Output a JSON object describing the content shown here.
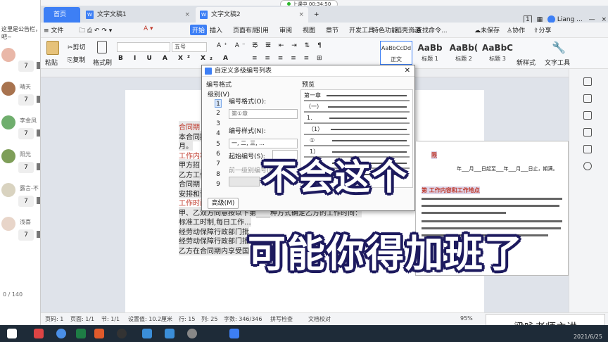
{
  "chat": {
    "notice": "这里是公告栏，\n吧~",
    "items": [
      {
        "name": "",
        "count": "7",
        "avatar_color": "#e9b7a8"
      },
      {
        "name": "晴天",
        "count": "7",
        "avatar_color": "#a8734f"
      },
      {
        "name": "李金凤",
        "count": "7",
        "avatar_color": "#6fae6d"
      },
      {
        "name": "阳光",
        "count": "7",
        "avatar_color": "#7e9e58"
      },
      {
        "name": "露言-不",
        "count": "7",
        "avatar_color": "#d9d3c0"
      },
      {
        "name": "浅喜",
        "count": "7",
        "avatar_color": "#e8d5c9"
      }
    ],
    "pager": "0 / 140"
  },
  "tabs": {
    "home": "首页",
    "doc1": "文字文稿1",
    "doc2": "文字文稿2",
    "add": "+",
    "timer": "上课中 00:34:50",
    "window_count": "1",
    "user": "Liang ..."
  },
  "menu": {
    "file": "≡ 文件",
    "start": "开始",
    "items": [
      "插入",
      "页面布局",
      "引用",
      "审阅",
      "视图",
      "章节",
      "开发工具",
      "特色功能",
      "稻壳资源"
    ],
    "search": "查找命令...",
    "unsaved": "未保存",
    "collab": "协作",
    "share": "分享"
  },
  "ribbon": {
    "paste": "粘贴",
    "cut": "剪切",
    "copy": "复制",
    "format_painter": "格式刷",
    "font_size": "五号",
    "styles": [
      {
        "sample": "AaBbCcDd",
        "label": "正文"
      },
      {
        "sample": "AaBb",
        "label": "标题 1"
      },
      {
        "sample": "AaBb(",
        "label": "标题 2"
      },
      {
        "sample": "AaBbC",
        "label": "标题 3"
      }
    ],
    "new_style": "新样式",
    "text_tools": "文字工具"
  },
  "document": {
    "lines": [
      {
        "text": "合同期",
        "style": "red hl"
      },
      {
        "text": "本合同期",
        "style": "hl"
      },
      {
        "text": "月。",
        "style": "hl"
      },
      {
        "text": "工作内容",
        "style": "red"
      },
      {
        "text": "甲方招",
        "style": "hl"
      },
      {
        "text": "乙方工作",
        "style": "hl"
      },
      {
        "text": "合同期",
        "style": "hl"
      },
      {
        "text": "安排和调整乙方的工作岗位、职务和相应的工资级别。乙方自愿服从甲方的安排和",
        "style": "hl"
      },
      {
        "text": "工作时间及休息休假",
        "style": "red"
      },
      {
        "text": "甲、乙双方同意按以下第____种方式确定乙方的工作时间：",
        "style": "hl"
      },
      {
        "text": "标准工时制,每日工作...",
        "style": "hl"
      },
      {
        "text": "经劳动保障行政部门批",
        "style": "hl"
      },
      {
        "text": "经劳动保障行政部门批",
        "style": "hl"
      },
      {
        "text": "乙方在合同期内享受国",
        "style": "hl"
      }
    ]
  },
  "dialog": {
    "title": "自定义多级编号列表",
    "section": "编号格式",
    "level_label": "级别(V)",
    "levels": [
      "1",
      "2",
      "3",
      "4",
      "5",
      "6",
      "7",
      "8",
      "9"
    ],
    "selected_level": "1",
    "format_label": "编号格式(O):",
    "format_value": "第①章",
    "style_label": "编号样式(N):",
    "style_value": "一, 二, 三, ...",
    "start_label": "起始编号(S):",
    "prev_level": "前一级别编号(P):",
    "advanced": "高级(M)",
    "preview_label": "预览",
    "preview_rows": [
      "第一章",
      "（一）",
      "1.",
      "（1）",
      "①",
      "1）",
      "a.",
      "a）"
    ]
  },
  "status": {
    "page_num": "页码: 1",
    "pages": "页面: 1/1",
    "section": "节: 1/1",
    "setting": "设置值: 10.2厘米",
    "row": "行: 15",
    "col": "列: 25",
    "words": "字数: 346/346",
    "spell": "拼写检查",
    "proof": "文档校对",
    "zoom": "95%"
  },
  "captions": {
    "line1": "不会这个",
    "line2": "可能你得加班了"
  },
  "overlay_doc": {
    "heading1": "限",
    "heading2": "第  工作内容和工作地点",
    "date_line": "年___月___日起至___年___月___日止，期满。"
  },
  "teacher": "梁咏老师主讲",
  "taskbar": {
    "date": "2021/6/25"
  }
}
